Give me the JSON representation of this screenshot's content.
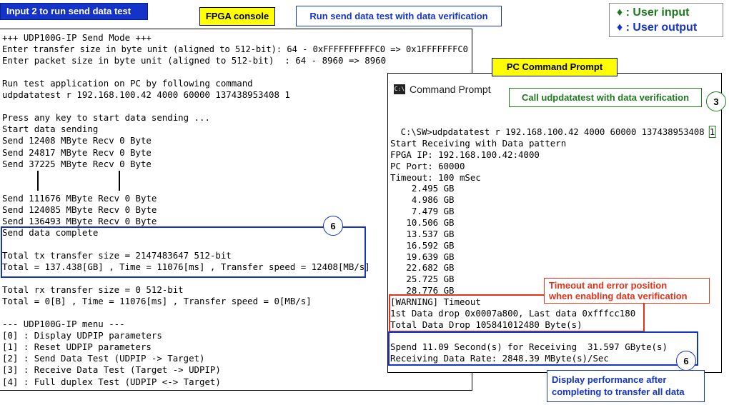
{
  "callouts": {
    "input2": "Input 2 to run send data test",
    "fpga_console": "FPGA console",
    "run_send": "Run send data test with data verification",
    "pc_prompt": "PC Command Prompt",
    "call_udp": "Call udpdatatest with data verification",
    "timeout_pos": [
      "Timeout and error position",
      "when enabling data verification"
    ],
    "display_perf": [
      "Display performance after",
      "completing to transfer all data"
    ]
  },
  "legend": {
    "user_input": "♦ : User input",
    "user_output": "♦ : User output",
    "input_color": "#1e7a1e",
    "output_color": "#1433c8"
  },
  "markers": {
    "m6_fpga": "6",
    "m3": "3",
    "m6_pc": "6"
  },
  "fpga_console": {
    "lines": [
      "+++ UDP100G-IP Send Mode +++",
      "Enter transfer size in byte unit (aligned to 512-bit): 64 - 0xFFFFFFFFFFC0 => 0x1FFFFFFFC0",
      "Enter packet size in byte unit (aligned to 512-bit)  : 64 - 8960 => 8960",
      "",
      "Run test application on PC by following command",
      "udpdatatest r 192.168.100.42 4000 60000 137438953408 1",
      "",
      "Press any key to start data sending ...",
      "Start data sending",
      "Send 12408 MByte Recv 0 Byte",
      "Send 24817 MByte Recv 0 Byte",
      "Send 37225 MByte Recv 0 Byte",
      "",
      "",
      "Send 111676 MByte Recv 0 Byte",
      "Send 124085 MByte Recv 0 Byte",
      "Send 136493 MByte Recv 0 Byte",
      "Send data complete",
      "",
      "Total tx transfer size = 2147483647 512-bit",
      "Total = 137.438[GB] , Time = 11076[ms] , Transfer speed = 12408[MB/s]",
      "",
      "Total rx transfer size = 0 512-bit",
      "Total = 0[B] , Time = 11076[ms] , Transfer speed = 0[MB/s]",
      "",
      "--- UDP100G-IP menu ---",
      "[0] : Display UDPIP parameters",
      "[1] : Reset UDPIP parameters",
      "[2] : Send Data Test (UDPIP -> Target)",
      "[3] : Receive Data Test (Target -> UDPIP)",
      "[4] : Full duplex Test (UDPIP <-> Target)"
    ]
  },
  "pc_prompt": {
    "title": "Command Prompt",
    "command_prefix": "C:\\SW>udpdatatest r 192.168.100.42 4000 60000 137438953408 ",
    "command_last": "1",
    "lines": [
      "Start Receiving with Data pattern",
      "FPGA IP: 192.168.100.42:4000",
      "PC Port: 60000",
      "Timeout: 100 mSec",
      "    2.495 GB",
      "    4.986 GB",
      "    7.479 GB",
      "   10.506 GB",
      "   13.537 GB",
      "   16.592 GB",
      "   19.639 GB",
      "   22.682 GB",
      "   25.725 GB",
      "   28.776 GB",
      "[WARNING] Timeout",
      "1st Data drop 0x0007a800, Last data 0xfffcc180",
      "Total Data Drop 105841012480 Byte(s)",
      "",
      "Spend 11.09 Second(s) for Receiving  31.597 GByte(s)",
      "Receiving Data Rate: 2848.39 MByte(s)/Sec"
    ]
  }
}
